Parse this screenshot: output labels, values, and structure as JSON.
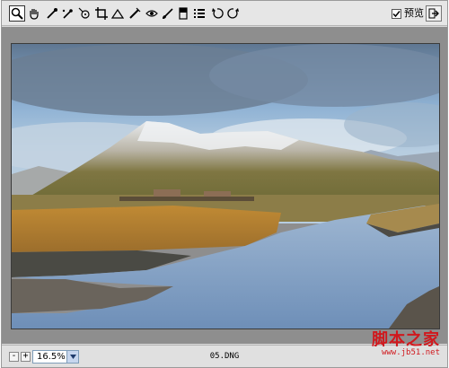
{
  "toolbar": {
    "tools": [
      {
        "name": "zoom-icon",
        "active": true
      },
      {
        "name": "hand-icon",
        "active": false
      },
      {
        "name": "white-balance-icon",
        "active": false
      },
      {
        "name": "color-sampler-icon",
        "active": false
      },
      {
        "name": "target-adjust-icon",
        "active": false
      },
      {
        "name": "crop-icon",
        "active": false
      },
      {
        "name": "straighten-icon",
        "active": false
      },
      {
        "name": "spot-removal-icon",
        "active": false
      },
      {
        "name": "red-eye-icon",
        "active": false
      },
      {
        "name": "brush-icon",
        "active": false
      },
      {
        "name": "graduated-filter-icon",
        "active": false
      },
      {
        "name": "preferences-icon",
        "active": false
      },
      {
        "name": "rotate-left-icon",
        "active": false
      },
      {
        "name": "rotate-right-icon",
        "active": false
      }
    ],
    "preview_checked": true,
    "preview_label": "预览",
    "exit_icon": "exit-icon"
  },
  "status": {
    "zoom_out": "-",
    "zoom_in": "+",
    "zoom_value": "16.5%",
    "filename": "05.DNG"
  },
  "watermark": {
    "main": "脚本之家",
    "sub": "www.jb51.net"
  },
  "colors": {
    "toolbar_bg": "#e6e6e6",
    "canvas_bg": "#8e8e8e",
    "watermark": "#d0181d"
  }
}
